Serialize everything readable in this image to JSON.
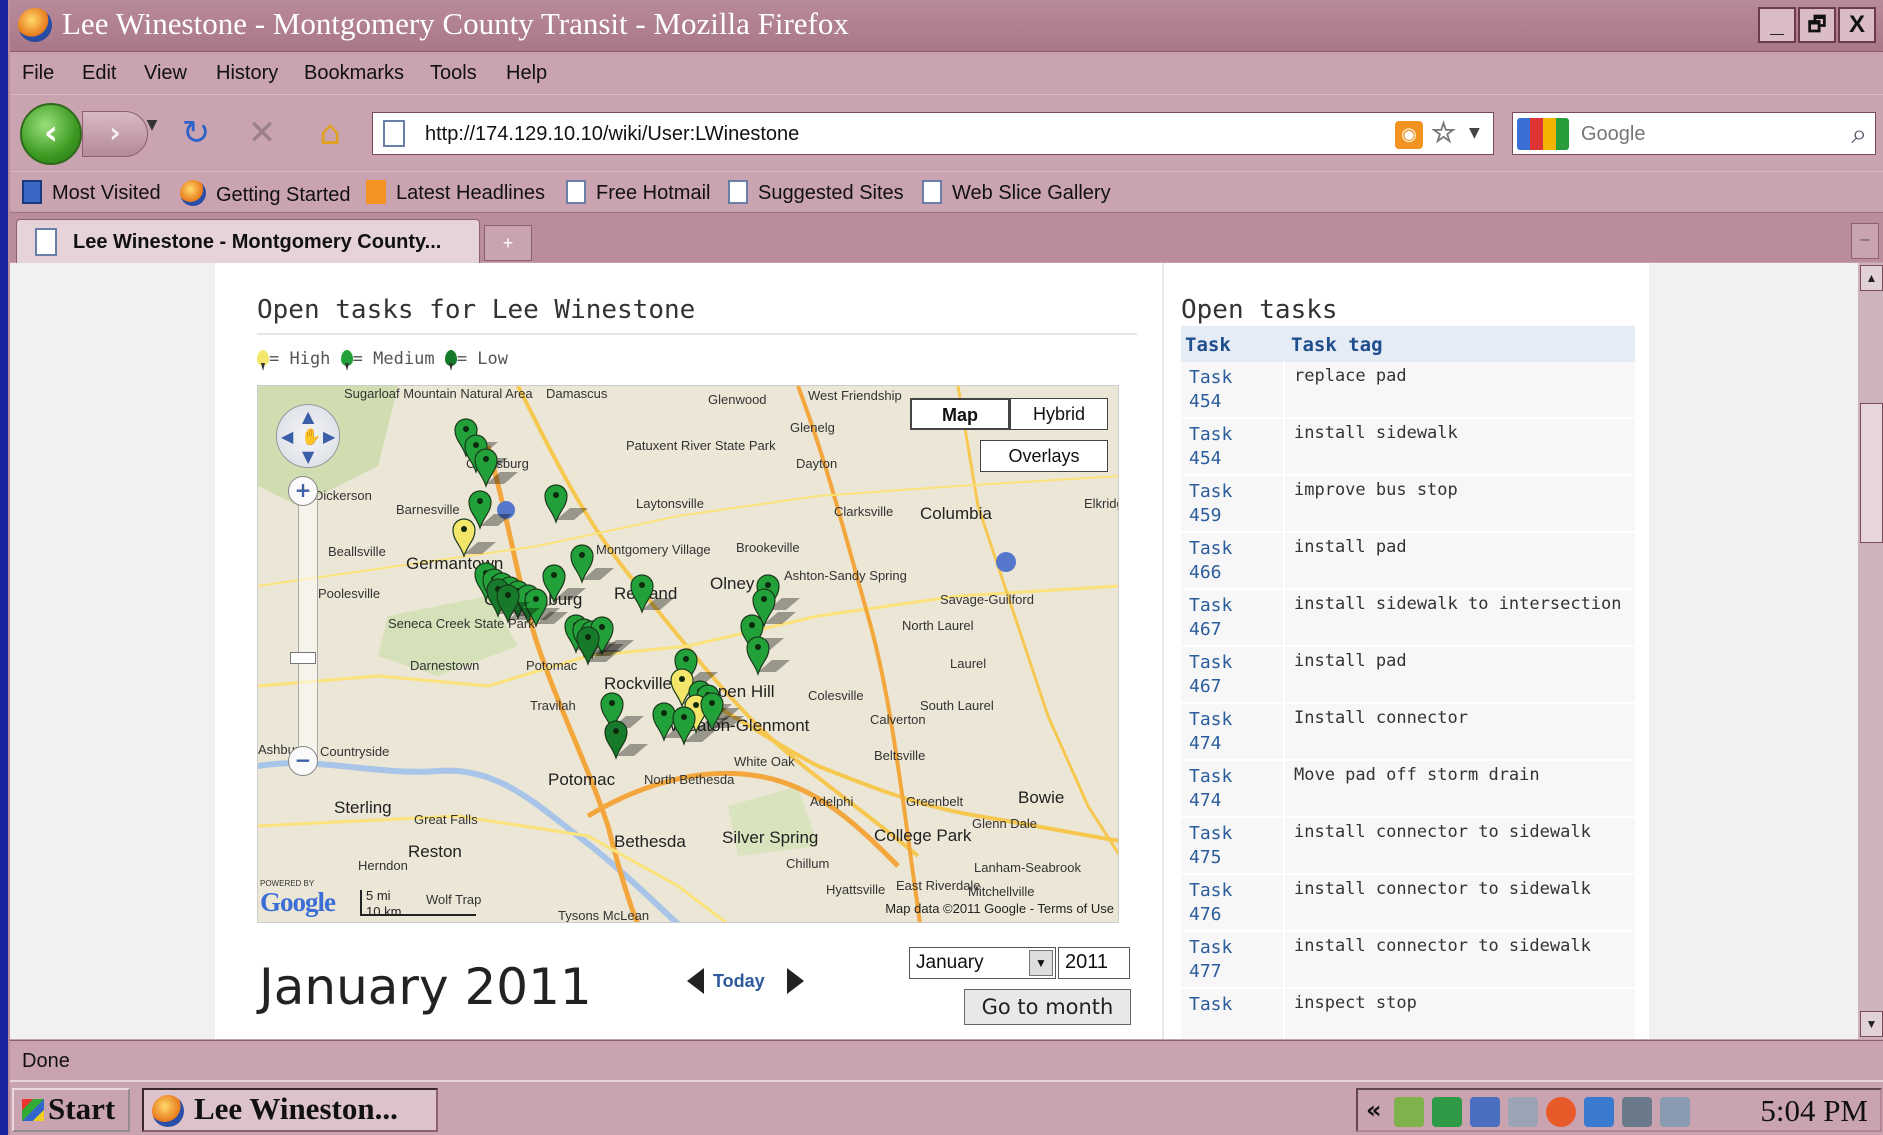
{
  "window": {
    "title": "Lee Winestone - Montgomery County Transit - Mozilla Firefox",
    "controls": [
      "_",
      "🗗",
      "X"
    ]
  },
  "menu": [
    "File",
    "Edit",
    "View",
    "History",
    "Bookmarks",
    "Tools",
    "Help"
  ],
  "nav": {
    "url": "http://174.129.10.10/wiki/User:LWinestone",
    "search_placeholder": "Google"
  },
  "bookmarks": [
    "Most Visited",
    "Getting Started",
    "Latest Headlines",
    "Free Hotmail",
    "Suggested Sites",
    "Web Slice Gallery"
  ],
  "tabs": [
    {
      "label": "Lee Winestone - Montgomery County..."
    }
  ],
  "page": {
    "left_heading": "Open tasks for Lee Winestone",
    "right_heading": "Open tasks",
    "legend": {
      "high": "= High",
      "medium": "= Medium",
      "low": "= Low"
    },
    "colors": {
      "high": "#f3e66a",
      "medium": "#22a13a",
      "low": "#167a2a"
    }
  },
  "map": {
    "type_buttons": [
      "Map",
      "Hybrid"
    ],
    "overlays_button": "Overlays",
    "logo": "Google",
    "powered_by": "POWERED BY",
    "scale": {
      "mi": "5 mi",
      "km": "10 km"
    },
    "copyright": "Map data ©2011 Google - Terms of Use",
    "towns": [
      "Sugarloaf Mountain Natural Area",
      "Damascus",
      "Glenwood",
      "West Friendship",
      "Glenelg",
      "Patuxent River State Park",
      "Dayton",
      "Clarksburg",
      "Dickerson",
      "Barnesville",
      "Laytonsville",
      "Clarksville",
      "Columbia",
      "Elkridge",
      "Beallsville",
      "Germantown",
      "Montgomery Village",
      "Brookeville",
      "Olney",
      "Ashton-Sandy Spring",
      "Poolesville",
      "Gaithersburg",
      "Redland",
      "Savage-Guilford",
      "Seneca Creek State Park",
      "North Laurel",
      "Darnestown",
      "Potomac",
      "Laurel",
      "Rockville",
      "Aspen Hill",
      "Colesville",
      "Travilah",
      "South Laurel",
      "Wheaton-Glenmont",
      "Calverton",
      "Ashburn",
      "Countryside",
      "White Oak",
      "Beltsville",
      "Sterling",
      "Potomac",
      "North Bethesda",
      "Adelphi",
      "Greenbelt",
      "Bowie",
      "Great Falls",
      "Glenn Dale",
      "Reston",
      "Bethesda",
      "Silver Spring",
      "College Park",
      "Herndon",
      "Chillum",
      "Lanham-Seabrook",
      "Hyattsville",
      "East Riverdale",
      "Mitchellville",
      "Tysons McLean",
      "Wolf Trap"
    ]
  },
  "calendar": {
    "title": "January 2011",
    "today_label": "Today",
    "month_value": "January",
    "year_value": "2011",
    "go_label": "Go to month"
  },
  "tasks_table": {
    "columns": [
      "Task",
      "Task tag"
    ],
    "rows": [
      {
        "task": "Task 454",
        "tag": "replace pad"
      },
      {
        "task": "Task 454",
        "tag": "install sidewalk"
      },
      {
        "task": "Task 459",
        "tag": "improve bus stop"
      },
      {
        "task": "Task 466",
        "tag": "install pad"
      },
      {
        "task": "Task 467",
        "tag": "install sidewalk to intersection"
      },
      {
        "task": "Task 467",
        "tag": "install pad"
      },
      {
        "task": "Task 474",
        "tag": "Install connector"
      },
      {
        "task": "Task 474",
        "tag": "Move pad off storm drain"
      },
      {
        "task": "Task 475",
        "tag": "install connector to sidewalk"
      },
      {
        "task": "Task 476",
        "tag": "install connector to sidewalk"
      },
      {
        "task": "Task 477",
        "tag": "install connector to sidewalk"
      },
      {
        "task": "Task",
        "tag": "inspect stop"
      }
    ]
  },
  "status": "Done",
  "taskbar": {
    "start": "Start",
    "window_button": "Lee Wineston...",
    "clock": "5:04 PM",
    "tray_chevron": "«"
  }
}
